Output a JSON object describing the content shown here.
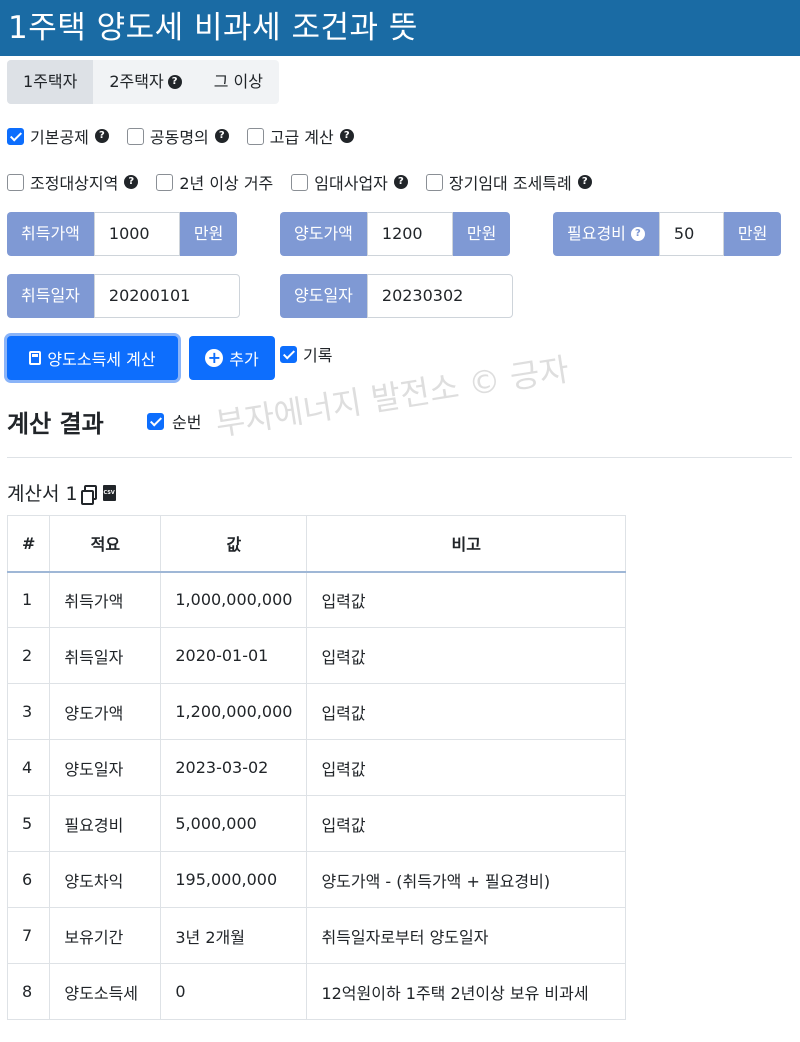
{
  "title": "1주택 양도세 비과세 조건과 뜻",
  "tabs": [
    {
      "label": "1주택자",
      "help": false,
      "active": true
    },
    {
      "label": "2주택자",
      "help": true,
      "active": false
    },
    {
      "label": "그 이상",
      "help": false,
      "active": false
    }
  ],
  "options_row1": [
    {
      "label": "기본공제",
      "checked": true,
      "help": true
    },
    {
      "label": "공동명의",
      "checked": false,
      "help": true
    },
    {
      "label": "고급 계산",
      "checked": false,
      "help": true
    }
  ],
  "options_row2": [
    {
      "label": "조정대상지역",
      "checked": false,
      "help": true
    },
    {
      "label": "2년 이상 거주",
      "checked": false,
      "help": false
    },
    {
      "label": "임대사업자",
      "checked": false,
      "help": true
    },
    {
      "label": "장기임대 조세특례",
      "checked": false,
      "help": true
    }
  ],
  "inputs": {
    "acq_price": {
      "label": "취득가액",
      "value": "1000",
      "unit": "만원"
    },
    "sale_price": {
      "label": "양도가액",
      "value": "1200",
      "unit": "만원"
    },
    "expense": {
      "label": "필요경비",
      "value": "50",
      "unit": "만원"
    },
    "acq_date": {
      "label": "취득일자",
      "value": "20200101"
    },
    "sale_date": {
      "label": "양도일자",
      "value": "20230302"
    }
  },
  "buttons": {
    "calc": "양도소득세 계산",
    "add": "추가"
  },
  "record_label": "기록",
  "results": {
    "title": "계산 결과",
    "order_label": "순번",
    "doc_title": "계산서 1",
    "watermark": "부자에너지 발전소 © 긍자",
    "headers": [
      "#",
      "적요",
      "값",
      "비고"
    ],
    "rows": [
      [
        "1",
        "취득가액",
        "1,000,000,000",
        "입력값"
      ],
      [
        "2",
        "취득일자",
        "2020-01-01",
        "입력값"
      ],
      [
        "3",
        "양도가액",
        "1,200,000,000",
        "입력값"
      ],
      [
        "4",
        "양도일자",
        "2023-03-02",
        "입력값"
      ],
      [
        "5",
        "필요경비",
        "5,000,000",
        "입력값"
      ],
      [
        "6",
        "양도차익",
        "195,000,000",
        "양도가액 - (취득가액 + 필요경비)"
      ],
      [
        "7",
        "보유기간",
        "3년 2개월",
        "취득일자로부터 양도일자"
      ],
      [
        "8",
        "양도소득세",
        "0",
        "12억원이하 1주택 2년이상 보유 비과세"
      ]
    ]
  },
  "colors": {
    "header_bg": "#1a6ba4",
    "label_bg": "#7f99d4",
    "primary": "#0d6efd"
  }
}
